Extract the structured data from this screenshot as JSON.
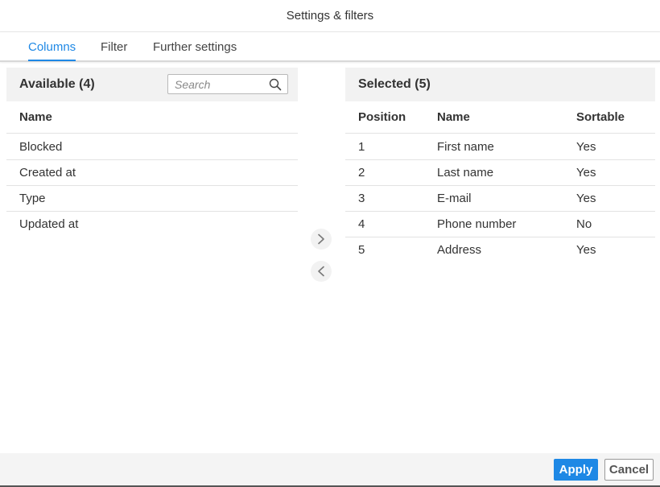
{
  "dialog": {
    "title": "Settings & filters"
  },
  "tabs": [
    {
      "label": "Columns",
      "active": true
    },
    {
      "label": "Filter",
      "active": false
    },
    {
      "label": "Further settings",
      "active": false
    }
  ],
  "available": {
    "title": "Available (4)",
    "search_placeholder": "Search",
    "search_value": "",
    "columns": [
      "Name"
    ],
    "rows": [
      "Blocked",
      "Created at",
      "Type",
      "Updated at"
    ]
  },
  "selected": {
    "title": "Selected (5)",
    "columns": [
      "Position",
      "Name",
      "Sortable"
    ],
    "rows": [
      {
        "position": "1",
        "name": "First name",
        "sortable": "Yes"
      },
      {
        "position": "2",
        "name": "Last name",
        "sortable": "Yes"
      },
      {
        "position": "3",
        "name": "E-mail",
        "sortable": "Yes"
      },
      {
        "position": "4",
        "name": "Phone number",
        "sortable": "No"
      },
      {
        "position": "5",
        "name": "Address",
        "sortable": "Yes"
      }
    ]
  },
  "transfer": {
    "add_icon": "chevron-right-icon",
    "remove_icon": "chevron-left-icon"
  },
  "footer": {
    "apply_label": "Apply",
    "cancel_label": "Cancel"
  },
  "colors": {
    "accent": "#1e88e5",
    "header_bg": "#f2f2f2",
    "footer_bg": "#f4f4f4"
  }
}
